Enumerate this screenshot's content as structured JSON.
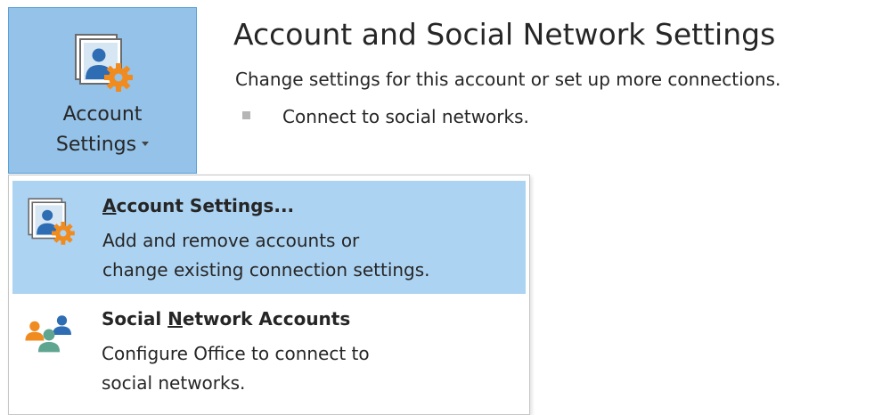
{
  "account_button": {
    "label_line1": "Account",
    "label_line2": "Settings",
    "icon": "account-settings-icon"
  },
  "info": {
    "title": "Account and Social Network Settings",
    "description": "Change settings for this account or set up more connections.",
    "bullet": "Connect to social networks."
  },
  "menu": {
    "items": [
      {
        "title_accel": "A",
        "title_rest": "ccount Settings...",
        "desc_line1": "Add and remove accounts or",
        "desc_line2": "change existing connection settings.",
        "icon": "account-settings-icon",
        "highlighted": true
      },
      {
        "title_pre": "Social ",
        "title_accel": "N",
        "title_rest": "etwork Accounts",
        "desc_line1": "Configure Office to connect to",
        "desc_line2": "social networks.",
        "icon": "social-network-people-icon",
        "highlighted": false
      }
    ]
  },
  "colors": {
    "button_bg": "#94c2e8",
    "menu_highlight": "#add3f2",
    "gear_orange": "#f08b1f",
    "person_blue": "#2e6db4"
  }
}
